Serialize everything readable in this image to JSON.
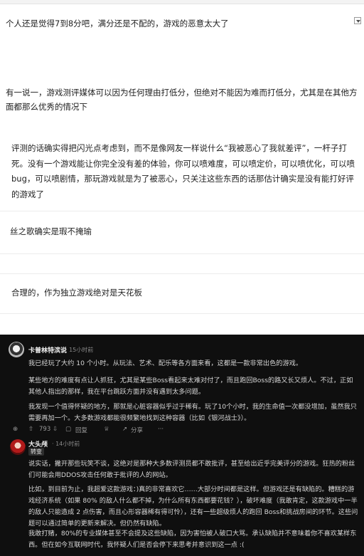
{
  "comments": [
    {
      "text": "个人还是觉得7到8分吧，满分还是不配的，游戏的恶意太大了"
    },
    {
      "text": "有一说一，游戏测评媒体可以因为任何理由打低分，但绝对不能因为难而打低分，尤其是在其他方面都那么优秀的情况下"
    },
    {
      "text": "评测的话确实得把闪光点考虑到，而不是像网友一样说什么“我被恶心了我就差评”，一杆子打死。没有一个游戏能让你完全没有差的体验，你可以喷难度，可以喷定价，可以喷优化，可以喷bug，可以喷剧情，那玩游戏就是为了被恶心，只关注这些东西的话那估计确实是没有能打好评的游戏了"
    },
    {
      "text": "丝之歌确实是瑕不掩瑜"
    },
    {
      "text": "合理的，作为独立游戏绝对是天花板"
    }
  ],
  "screenshot": {
    "post1": {
      "username": "卡普林特滨说",
      "time": "· 15小时前",
      "paragraphs": [
        "我已经玩了大约 10 个小时。从玩法、艺术、配乐等各方面来看，这都是一款非常出色的游戏。",
        "某些地方的难度有点让人抓狂，尤其是某些Boss看起来太难对付了，而且跑回Boss的路又长又烦人。不过，正如其他人指出的那样，我在平台跳跃方面并没有遇到太多问题。",
        "我发现一个值得怀疑的地方，那就是心脏容器似乎过于稀有。玩了10个小时，我的生命值一次都没增加，虽然我只需要再加一个。大多数游戏都能很频繁地找到这种容器（比如《银河战士》）。"
      ],
      "actions": {
        "more": "⊕",
        "upvote_icon": "⇧",
        "count": "793",
        "downvote_icon": "⇩",
        "reply_icon": "▢",
        "reply": "回复",
        "award_icon": "♕",
        "share_icon": "↗",
        "share": "分享",
        "dots": "···"
      }
    },
    "post2": {
      "username": "大头颅",
      "time": "· 14小时前",
      "badge": "转变",
      "paragraphs": [
        "说实话，撇开那些玩笑不谈，这绝对是那种大多数评测员都不敢批评，甚至给出近乎完美评分的游戏。狂热的粉丝们可能会用DDOS攻击任何敢于批评的人的网站。",
        "比如，到目前为止，我超爱这款游戏：)真的非常喜欢它……大部分时间都是这样。但游戏还是有缺陷的。糟糕的游戏经济系统（如果 80% 的敌人什么都不掉，为什么所有东西都要花钱？），破坏难度（我敢肯定，这款游戏中一半的敌人只能造成 2 点伤害，而且心形容器稀有得可怜），还有一些超级烦人的跑回 Boss和挑战房间的环节。这些问题可以通过简单的更新来解决。但仍然有缺陷。",
        "我敢打赌，80%的专业媒体甚至不会提及这些缺陷，因为害怕被人破口大骂。承认缺陷并不意味着你不喜欢某样东西。但在如今互联网时代，我怀疑人们是否会停下来思考并意识到这一点 :("
      ]
    }
  }
}
